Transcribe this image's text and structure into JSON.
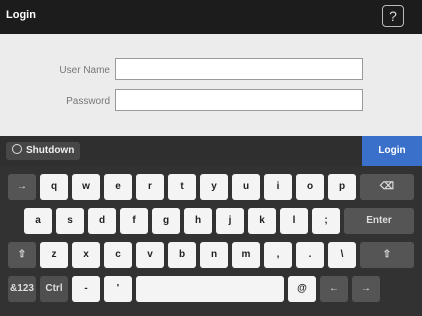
{
  "title": "Login",
  "help_icon": "?",
  "form": {
    "username_label": "User Name",
    "username_value": "",
    "password_label": "Password",
    "password_value": ""
  },
  "actions": {
    "shutdown_label": "Shutdown",
    "login_label": "Login"
  },
  "keyboard": {
    "row1": [
      "→",
      "q",
      "w",
      "e",
      "r",
      "t",
      "y",
      "u",
      "i",
      "o",
      "p",
      "⌫"
    ],
    "row2": [
      "a",
      "s",
      "d",
      "f",
      "g",
      "h",
      "j",
      "k",
      "l",
      ";",
      "Enter"
    ],
    "row3": [
      "⇧",
      "z",
      "x",
      "c",
      "v",
      "b",
      "n",
      "m",
      ",",
      ".",
      "\\",
      "⇧"
    ],
    "row4": [
      "&123",
      "Ctrl",
      "-",
      "'",
      "",
      "@",
      "←",
      "→"
    ]
  }
}
